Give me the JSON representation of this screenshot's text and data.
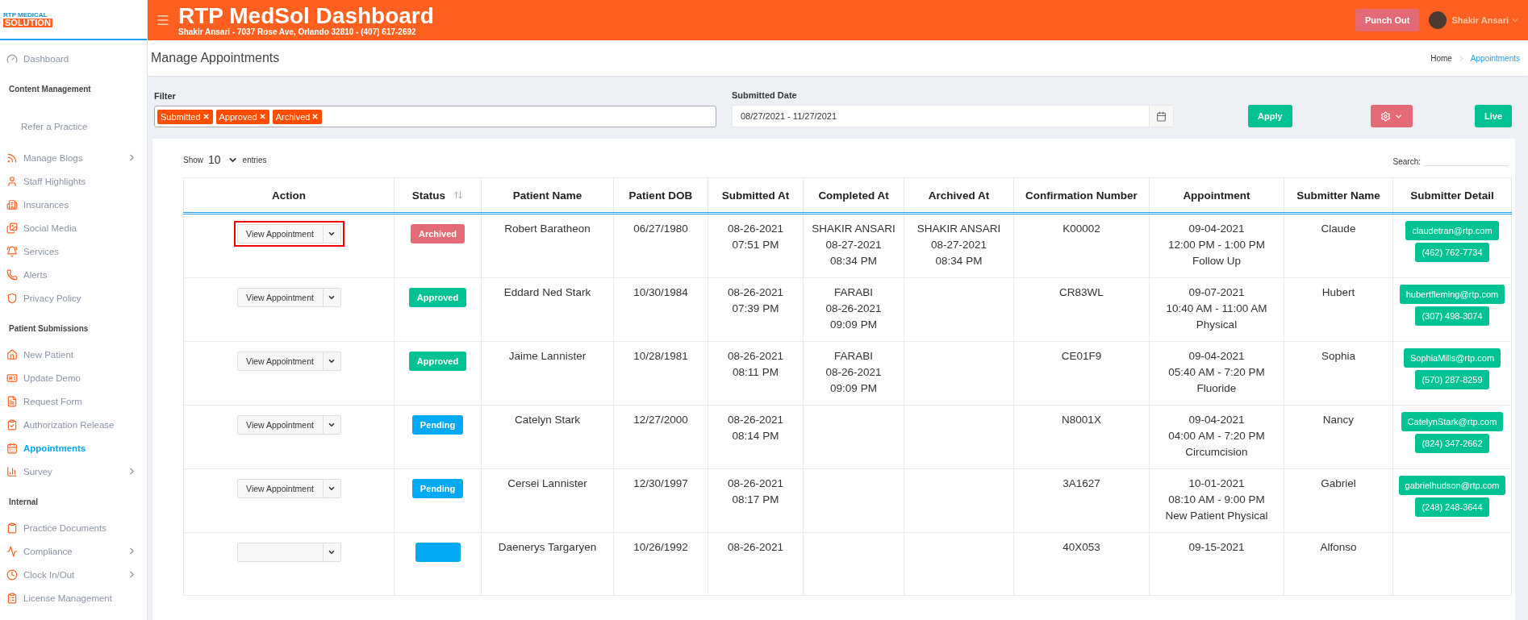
{
  "logo": {
    "line_1": "RTP MEDICAL",
    "line_2": "SOLUTION"
  },
  "header": {
    "title": "RTP MedSol Dashboard",
    "subtitle": "Shakir Ansari - 7037 Rose Ave, Orlando 32810 - (407) 617-2692",
    "punch_out": "Punch Out",
    "user_name": "Shakir Ansari"
  },
  "sidebar": {
    "sections": [
      {
        "items": [
          {
            "label": "Dashboard",
            "selected": false,
            "expandable": false
          }
        ]
      },
      {
        "title": "Content Management",
        "items": [
          {
            "label": "Refer a Practice",
            "selected": false,
            "expandable": false
          },
          {
            "label": "Manage Blogs",
            "selected": false,
            "expandable": true
          },
          {
            "label": "Staff Highlights",
            "selected": false,
            "expandable": false
          },
          {
            "label": "Insurances",
            "selected": false,
            "expandable": false
          },
          {
            "label": "Social Media",
            "selected": false,
            "expandable": false
          },
          {
            "label": "Services",
            "selected": false,
            "expandable": false
          },
          {
            "label": "Alerts",
            "selected": false,
            "expandable": false
          },
          {
            "label": "Privacy Policy",
            "selected": false,
            "expandable": false
          }
        ]
      },
      {
        "title": "Patient Submissions",
        "items": [
          {
            "label": "New Patient",
            "selected": false,
            "expandable": false
          },
          {
            "label": "Update Demo",
            "selected": false,
            "expandable": false
          },
          {
            "label": "Request Form",
            "selected": false,
            "expandable": false
          },
          {
            "label": "Authorization Release",
            "selected": false,
            "expandable": false
          },
          {
            "label": "Appointments",
            "selected": true,
            "expandable": false
          },
          {
            "label": "Survey",
            "selected": false,
            "expandable": true
          }
        ]
      },
      {
        "title": "Internal",
        "items": [
          {
            "label": "Practice Documents",
            "selected": false,
            "expandable": false
          },
          {
            "label": "Compliance",
            "selected": false,
            "expandable": true
          },
          {
            "label": "Clock In/Out",
            "selected": false,
            "expandable": true
          },
          {
            "label": "License Management",
            "selected": false,
            "expandable": false
          }
        ]
      }
    ]
  },
  "page_title": "Manage Appointments",
  "breadcrumb": [
    {
      "label": "Home",
      "selected": false
    },
    {
      "label": "Appointments",
      "selected": true
    }
  ],
  "filter": {
    "label": "Filter",
    "tags": [
      "Submitted",
      "Approved",
      "Archived"
    ]
  },
  "submitted_date": {
    "label": "Submitted Date",
    "value": "08/27/2021 - 11/27/2021"
  },
  "buttons": {
    "apply": "Apply",
    "live": "Live"
  },
  "table_controls": {
    "show": "Show",
    "page_size": "10",
    "entries": "entries",
    "search_label": "Search:"
  },
  "table": {
    "columns": [
      "Action",
      "Status",
      "Patient Name",
      "Patient DOB",
      "Submitted At",
      "Completed At",
      "Archived At",
      "Confirmation Number",
      "Appointment",
      "Submitter Name",
      "Submitter Detail"
    ],
    "rows": [
      {
        "action": "View Appointment",
        "highlighted": true,
        "status": {
          "label": "Archived",
          "kind": "archived"
        },
        "patient_name": "Robert Baratheon",
        "patient_dob": "06/27/1980",
        "submitted_at": [
          "08-26-2021",
          "07:51 PM"
        ],
        "completed_at": [
          "SHAKIR ANSARI",
          "08-27-2021",
          "08:34 PM"
        ],
        "archived_at": [
          "SHAKIR ANSARI",
          "08-27-2021",
          "08:34 PM"
        ],
        "confirmation": "K00002",
        "appointment": [
          "09-04-2021",
          "12:00 PM - 1:00 PM",
          "Follow Up"
        ],
        "submitter_name": "Claude",
        "submitter_detail": [
          "claudetran@rtp.com",
          "(462) 762-7734"
        ]
      },
      {
        "action": "View Appointment",
        "highlighted": false,
        "status": {
          "label": "Approved",
          "kind": "approved"
        },
        "patient_name": "Eddard Ned Stark",
        "patient_dob": "10/30/1984",
        "submitted_at": [
          "08-26-2021",
          "07:39 PM"
        ],
        "completed_at": [
          "FARABI",
          "08-26-2021",
          "09:09 PM"
        ],
        "archived_at": [],
        "confirmation": "CR83WL",
        "appointment": [
          "09-07-2021",
          "10:40 AM - 11:00 AM",
          "Physical"
        ],
        "submitter_name": "Hubert",
        "submitter_detail": [
          "hubertfleming@rtp.com",
          "(307) 498-3074"
        ]
      },
      {
        "action": "View Appointment",
        "highlighted": false,
        "status": {
          "label": "Approved",
          "kind": "approved"
        },
        "patient_name": "Jaime Lannister",
        "patient_dob": "10/28/1981",
        "submitted_at": [
          "08-26-2021",
          "08:11 PM"
        ],
        "completed_at": [
          "FARABI",
          "08-26-2021",
          "09:09 PM"
        ],
        "archived_at": [],
        "confirmation": "CE01F9",
        "appointment": [
          "09-04-2021",
          "05:40 AM - 7:20 PM",
          "Fluoride"
        ],
        "submitter_name": "Sophia",
        "submitter_detail": [
          "SophiaMills@rtp.com",
          "(570) 287-8259"
        ]
      },
      {
        "action": "View Appointment",
        "highlighted": false,
        "status": {
          "label": "Pending",
          "kind": "pending"
        },
        "patient_name": "Catelyn Stark",
        "patient_dob": "12/27/2000",
        "submitted_at": [
          "08-26-2021",
          "08:14 PM"
        ],
        "completed_at": [],
        "archived_at": [],
        "confirmation": "N8001X",
        "appointment": [
          "09-04-2021",
          "04:00 AM - 7:20 PM",
          "Circumcision"
        ],
        "submitter_name": "Nancy",
        "submitter_detail": [
          "CatelynStark@rtp.com",
          "(824) 347-2662"
        ]
      },
      {
        "action": "View Appointment",
        "highlighted": false,
        "status": {
          "label": "Pending",
          "kind": "pending"
        },
        "patient_name": "Cersei Lannister",
        "patient_dob": "12/30/1997",
        "submitted_at": [
          "08-26-2021",
          "08:17 PM"
        ],
        "completed_at": [],
        "archived_at": [],
        "confirmation": "3A1627",
        "appointment": [
          "10-01-2021",
          "08:10 AM - 9:00 PM",
          "New Patient Physical"
        ],
        "submitter_name": "Gabriel",
        "submitter_detail": [
          "gabrielhudson@rtp.com",
          "(248) 248-3644"
        ]
      },
      {
        "highlighted": false,
        "status": {
          "kind": "pending"
        },
        "patient_name": "Daenerys Targaryen",
        "patient_dob": "10/26/1992",
        "submitted_at": [
          "08-26-2021"
        ],
        "completed_at": [],
        "archived_at": [],
        "confirmation": "40X053",
        "appointment": [
          "09-15-2021"
        ],
        "submitter_name": "Alfonso",
        "submitter_detail": []
      }
    ]
  }
}
